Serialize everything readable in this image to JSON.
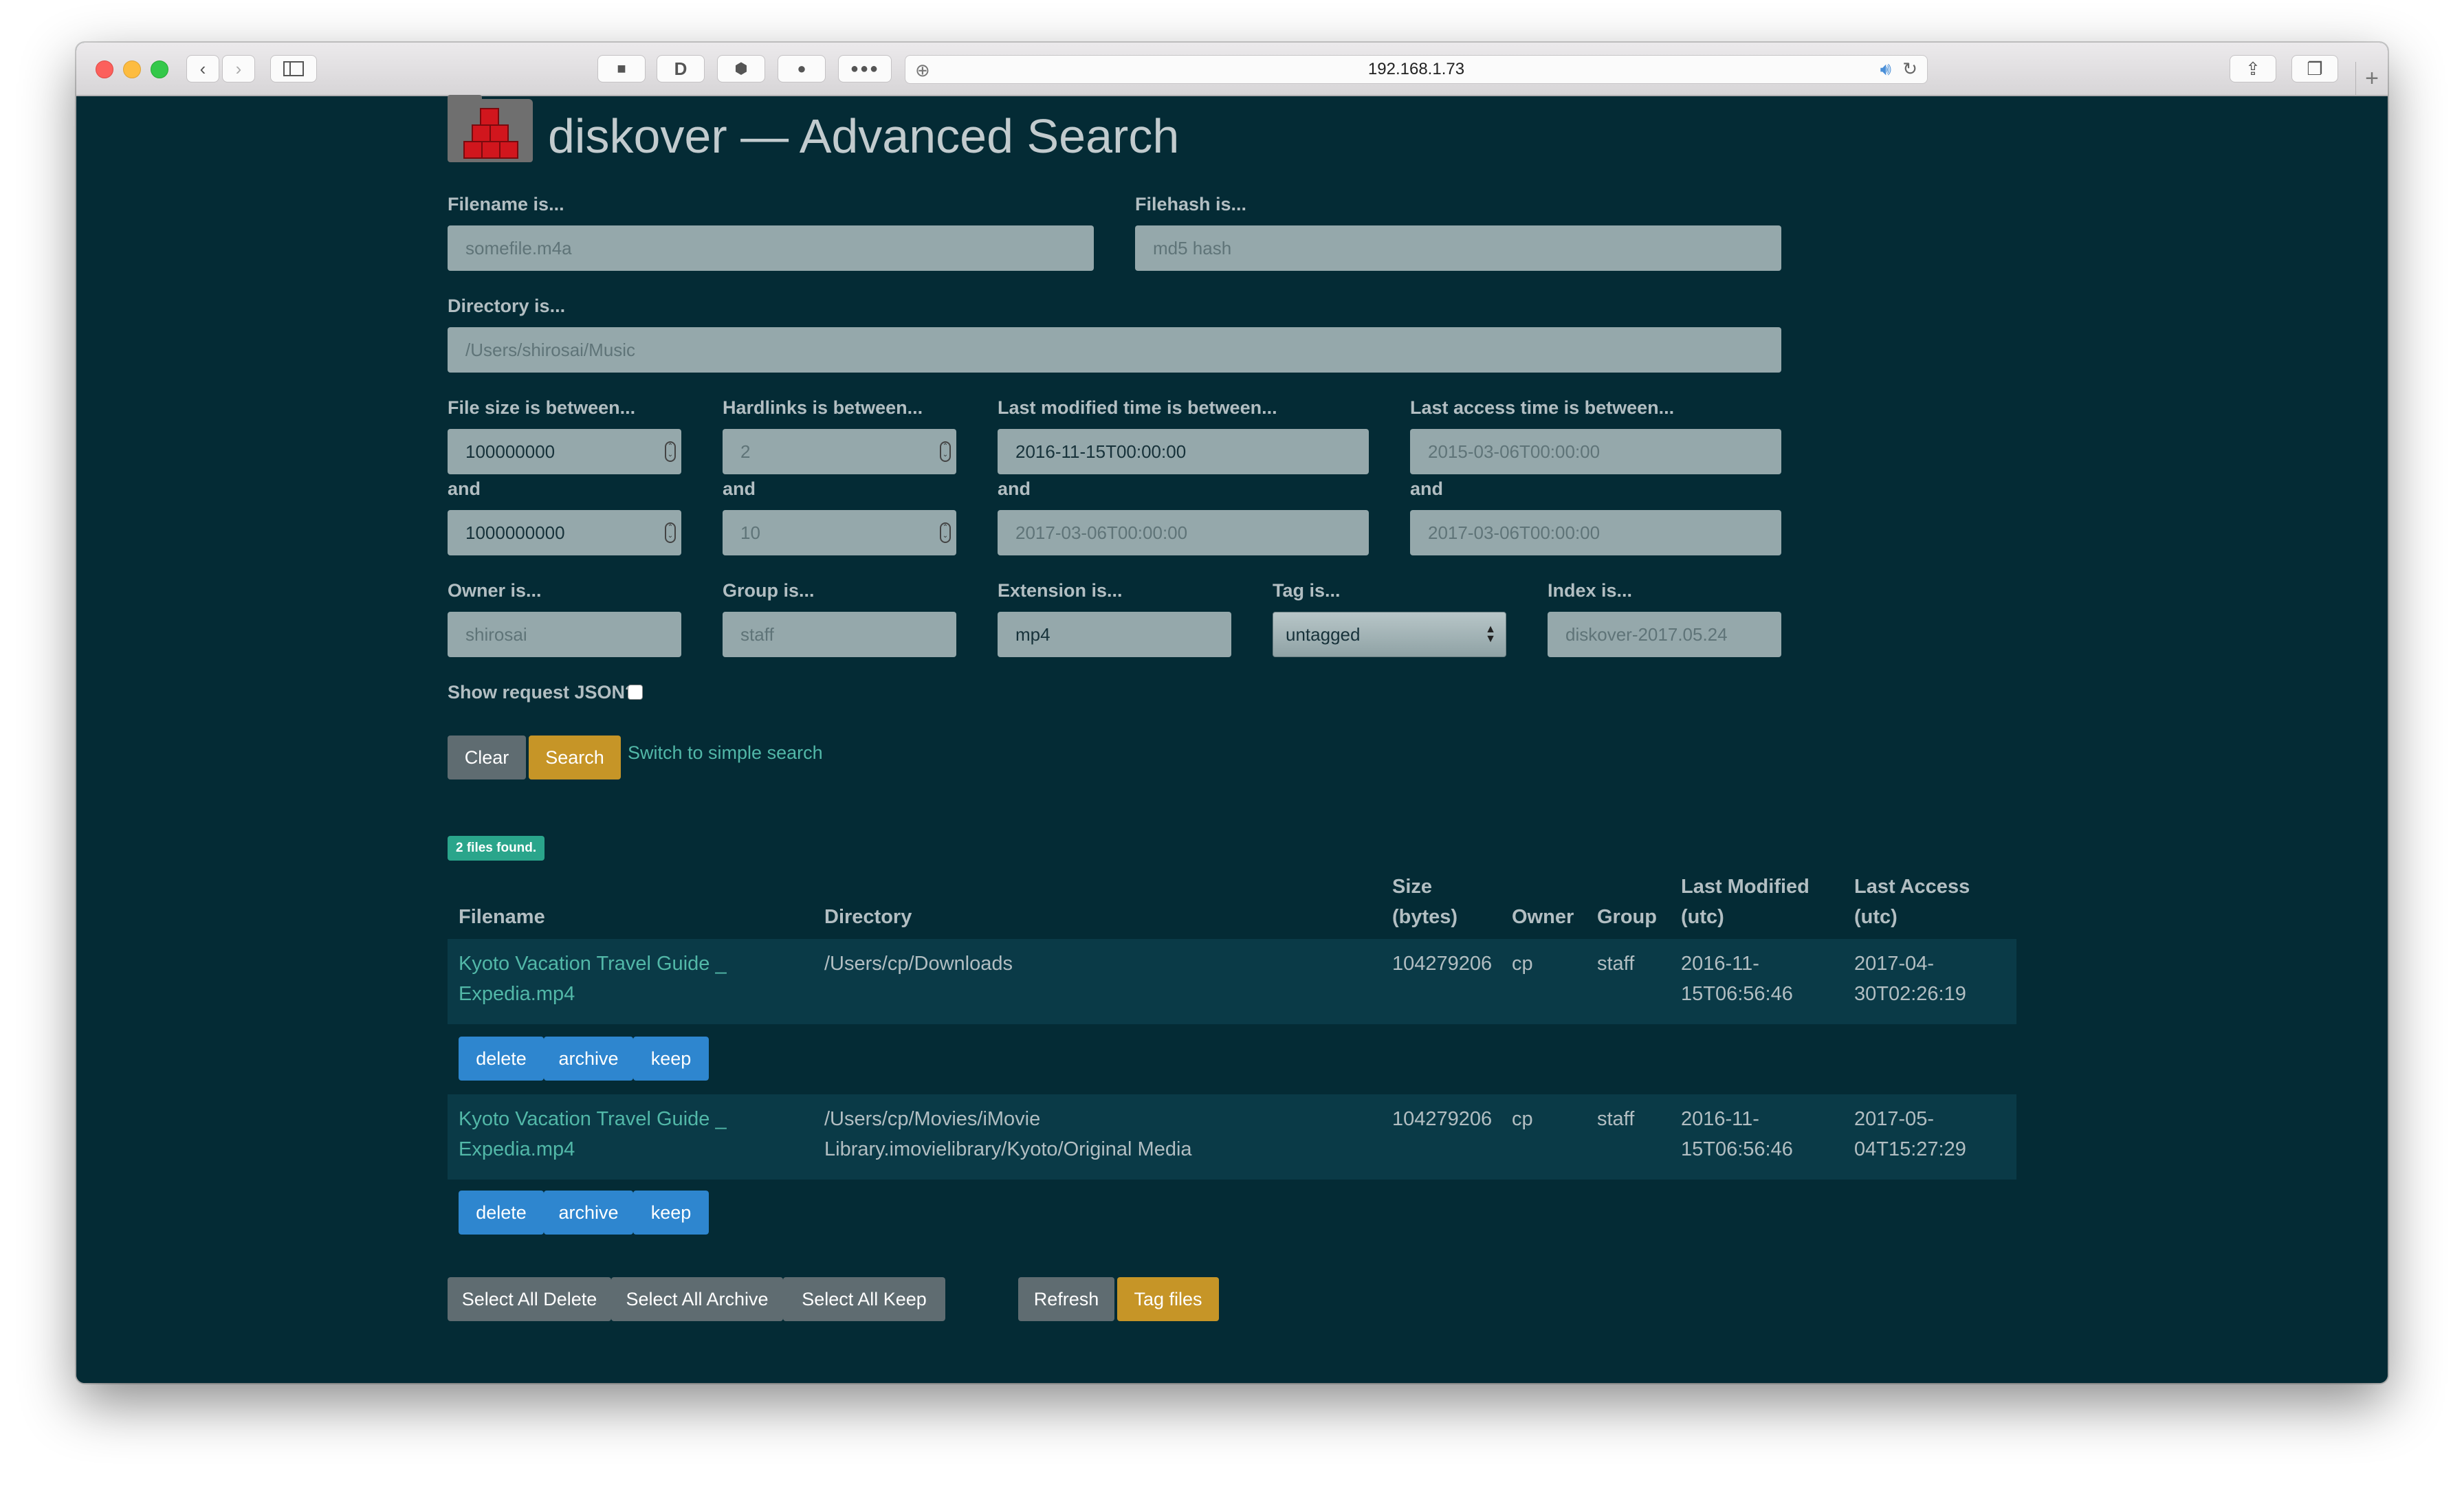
{
  "browser": {
    "url": "192.168.1.73"
  },
  "page": {
    "title": "diskover — Advanced Search"
  },
  "form": {
    "filename": {
      "label": "Filename is...",
      "placeholder": "somefile.m4a"
    },
    "filehash": {
      "label": "Filehash is...",
      "placeholder": "md5 hash"
    },
    "directory": {
      "label": "Directory is...",
      "placeholder": "/Users/shirosai/Music"
    },
    "filesize": {
      "label": "File size is between...",
      "min": "100000000",
      "and_label": "and",
      "max": "1000000000"
    },
    "hardlinks": {
      "label": "Hardlinks is between...",
      "min_placeholder": "2",
      "and_label": "and",
      "max_placeholder": "10"
    },
    "mtime": {
      "label": "Last modified time is between...",
      "from": "2016-11-15T00:00:00",
      "and_label": "and",
      "to_placeholder": "2017-03-06T00:00:00"
    },
    "atime": {
      "label": "Last access time is between...",
      "from_placeholder": "2015-03-06T00:00:00",
      "and_label": "and",
      "to_placeholder": "2017-03-06T00:00:00"
    },
    "owner": {
      "label": "Owner is...",
      "placeholder": "shirosai"
    },
    "group": {
      "label": "Group is...",
      "placeholder": "staff"
    },
    "extension": {
      "label": "Extension is...",
      "value": "mp4"
    },
    "tag": {
      "label": "Tag is...",
      "value": "untagged"
    },
    "index": {
      "label": "Index is...",
      "placeholder": "diskover-2017.05.24"
    },
    "show_json": {
      "label": "Show request JSON?"
    }
  },
  "actions": {
    "clear": "Clear",
    "search": "Search",
    "switch_link": "Switch to simple search"
  },
  "results": {
    "count_badge": "2 files found.",
    "headers": {
      "filename": "Filename",
      "directory": "Directory",
      "size_1": "Size",
      "size_2": "(bytes)",
      "owner": "Owner",
      "group": "Group",
      "modified_1": "Last Modified",
      "modified_2": "(utc)",
      "access_1": "Last Access",
      "access_2": "(utc)"
    },
    "rows": [
      {
        "filename_1": "Kyoto Vacation Travel Guide _",
        "filename_2": "Expedia.mp4",
        "directory_1": "/Users/cp/Downloads",
        "directory_2": "",
        "size": "104279206",
        "owner": "cp",
        "group": "staff",
        "modified_1": "2016-11-",
        "modified_2": "15T06:56:46",
        "access_1": "2017-04-",
        "access_2": "30T02:26:19"
      },
      {
        "filename_1": "Kyoto Vacation Travel Guide _",
        "filename_2": "Expedia.mp4",
        "directory_1": "/Users/cp/Movies/iMovie",
        "directory_2": "Library.imovielibrary/Kyoto/Original Media",
        "size": "104279206",
        "owner": "cp",
        "group": "staff",
        "modified_1": "2016-11-",
        "modified_2": "15T06:56:46",
        "access_1": "2017-05-",
        "access_2": "04T15:27:29"
      }
    ],
    "row_actions": {
      "delete": "delete",
      "archive": "archive",
      "keep": "keep"
    }
  },
  "bulk": {
    "select_delete": "Select All Delete",
    "select_archive": "Select All Archive",
    "select_keep": "Select All Keep",
    "refresh": "Refresh",
    "tag_files": "Tag files"
  },
  "colors": {
    "background": "#042b35",
    "accent_gold": "#c69527",
    "accent_blue": "#2e86cf",
    "link_teal": "#52b8a8",
    "badge": "#2aa58b"
  }
}
